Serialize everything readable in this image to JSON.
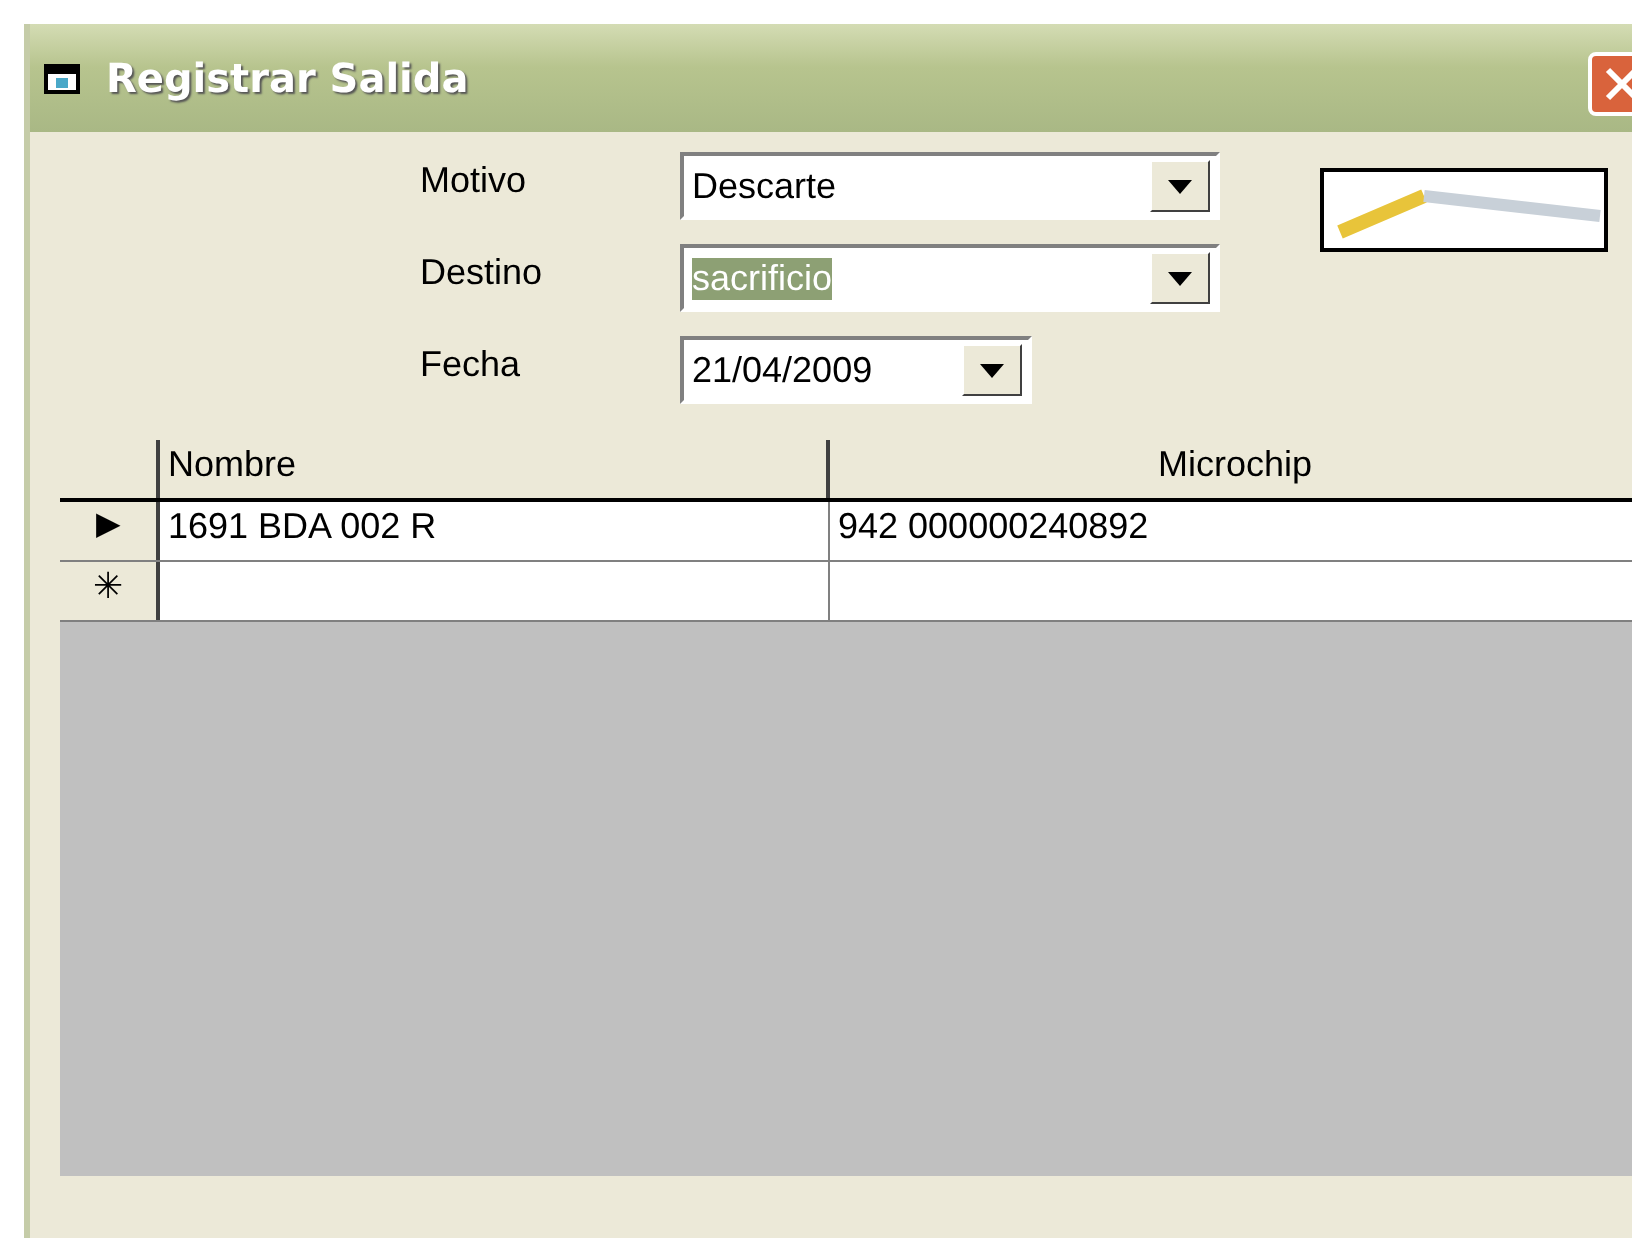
{
  "window": {
    "title": "Registrar Salida"
  },
  "form": [
    {
      "kind": "combo",
      "label": "Motivo",
      "value": "Descarte",
      "text_selected": false
    },
    {
      "kind": "combo",
      "label": "Destino",
      "value": "sacrificio",
      "text_selected": true
    },
    {
      "kind": "date",
      "label": "Fecha",
      "value": "21/04/2009",
      "text_selected": false
    }
  ],
  "table": {
    "columns": [
      "Nombre",
      "Microchip"
    ],
    "rows": [
      {
        "kind": "current",
        "marker": "▶",
        "cells": [
          "1691 BDA 002 R",
          "942 000000240892"
        ]
      },
      {
        "kind": "new",
        "marker": "✳",
        "cells": [
          "",
          ""
        ]
      }
    ]
  }
}
